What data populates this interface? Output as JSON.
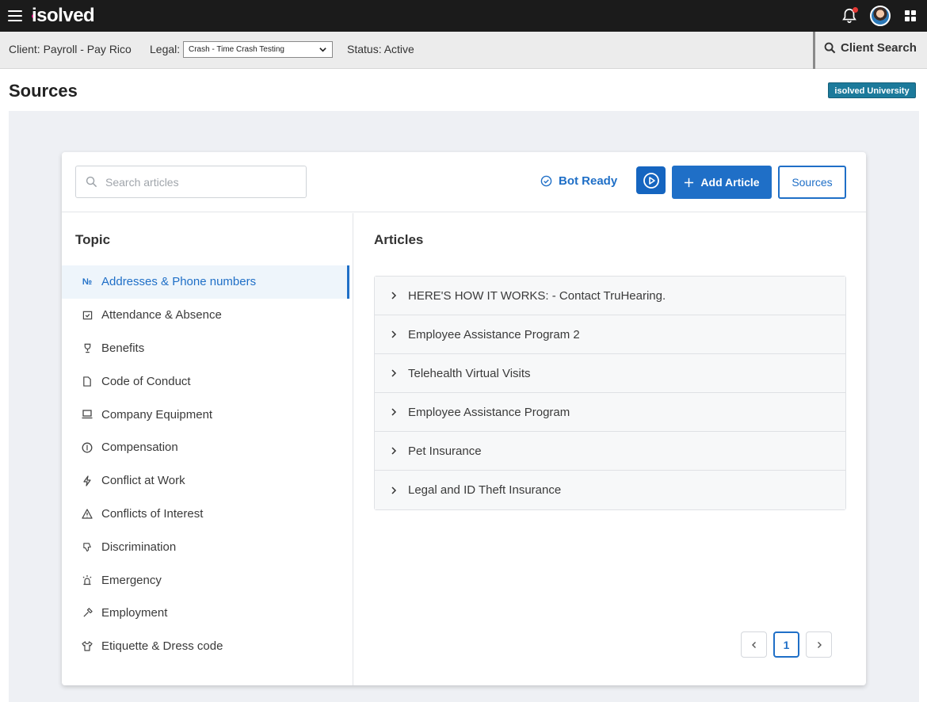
{
  "topbar": {
    "logo": "isolved"
  },
  "client_bar": {
    "client": "Client: Payroll - Pay Rico",
    "legal_label": "Legal:",
    "legal_value": "Crash - Time Crash Testing",
    "status": "Status: Active",
    "client_search": "Client Search"
  },
  "page": {
    "title": "Sources",
    "university_badge": "isolved University"
  },
  "toolbar": {
    "search_placeholder": "Search articles",
    "bot_status": "Bot Ready",
    "add_article": "Add Article",
    "sources": "Sources"
  },
  "topics": {
    "title": "Topic",
    "items": [
      {
        "label": "Addresses & Phone numbers",
        "icon": "numero-icon",
        "active": true
      },
      {
        "label": "Attendance & Absence",
        "icon": "calendar-check-icon",
        "active": false
      },
      {
        "label": "Benefits",
        "icon": "trophy-icon",
        "active": false
      },
      {
        "label": "Code of Conduct",
        "icon": "document-icon",
        "active": false
      },
      {
        "label": "Company Equipment",
        "icon": "laptop-icon",
        "active": false
      },
      {
        "label": "Compensation",
        "icon": "coin-icon",
        "active": false
      },
      {
        "label": "Conflict at Work",
        "icon": "lightning-icon",
        "active": false
      },
      {
        "label": "Conflicts of Interest",
        "icon": "warning-icon",
        "active": false
      },
      {
        "label": "Discrimination",
        "icon": "thumbs-down-icon",
        "active": false
      },
      {
        "label": "Emergency",
        "icon": "alarm-icon",
        "active": false
      },
      {
        "label": "Employment",
        "icon": "hammer-icon",
        "active": false
      },
      {
        "label": "Etiquette & Dress code",
        "icon": "shirt-icon",
        "active": false
      }
    ]
  },
  "articles": {
    "title": "Articles",
    "items": [
      "HERE'S HOW IT WORKS: - Contact TruHearing.",
      "Employee Assistance Program 2",
      "Telehealth Virtual Visits",
      "Employee Assistance Program",
      "Pet Insurance",
      "Legal and ID Theft Insurance"
    ]
  },
  "pagination": {
    "current_page": "1"
  },
  "colors": {
    "accent": "#1f6fc7",
    "topbar": "#1b1b1b",
    "badge": "#1c7a9b",
    "logo_dot": "#e6007e"
  }
}
